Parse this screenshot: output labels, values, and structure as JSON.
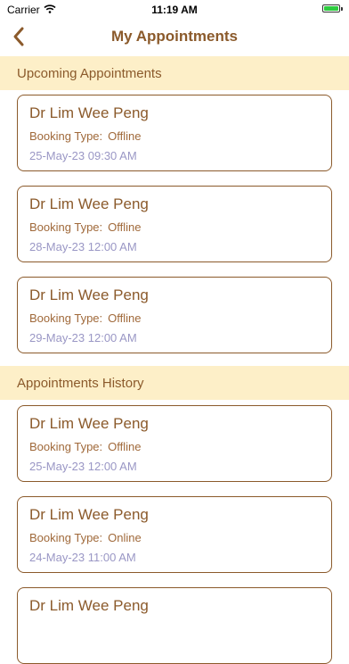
{
  "status_bar": {
    "carrier": "Carrier",
    "time": "11:19 AM",
    "wifi_icon": "wifi-icon",
    "battery_icon": "battery-icon"
  },
  "nav": {
    "title": "My Appointments",
    "back_icon": "chevron-left-icon",
    "accent_color": "#8b5a2b"
  },
  "upcoming": {
    "title": "Upcoming Appointments",
    "items": [
      {
        "doctor": "Dr Lim Wee Peng",
        "booking_label": "Booking Type:",
        "booking_value": "Offline",
        "date": "25-May-23 09:30 AM"
      },
      {
        "doctor": "Dr Lim Wee Peng",
        "booking_label": "Booking Type:",
        "booking_value": "Offline",
        "date": "28-May-23 12:00 AM"
      },
      {
        "doctor": "Dr Lim Wee Peng",
        "booking_label": "Booking Type:",
        "booking_value": "Offline",
        "date": "29-May-23 12:00 AM"
      }
    ]
  },
  "history": {
    "title": "Appointments History",
    "items": [
      {
        "doctor": "Dr Lim Wee Peng",
        "booking_label": "Booking Type:",
        "booking_value": "Offline",
        "date": "25-May-23 12:00 AM"
      },
      {
        "doctor": "Dr Lim Wee Peng",
        "booking_label": "Booking Type:",
        "booking_value": "Online",
        "date": "24-May-23 11:00 AM"
      },
      {
        "doctor": "Dr Lim Wee Peng"
      }
    ]
  },
  "colors": {
    "section_background": "#fdefc8",
    "date_text": "#9a97c5"
  }
}
